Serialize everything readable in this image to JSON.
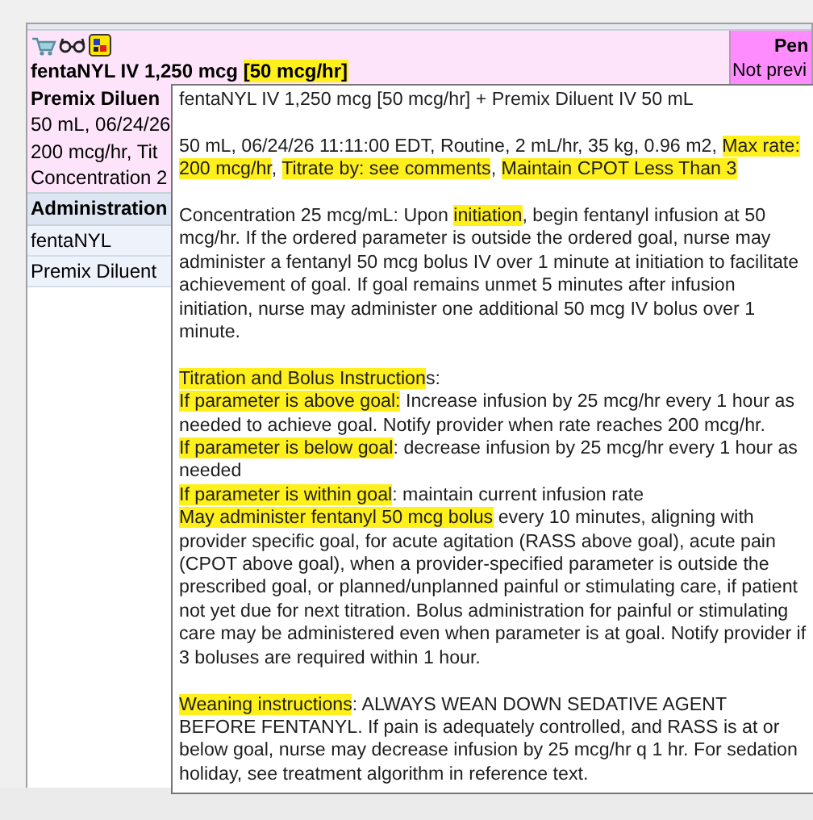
{
  "order": {
    "title": [
      {
        "text": "fentaNYL IV 1,250 mcg ",
        "highlight": false
      },
      {
        "text": "[50 mcg/hr]",
        "highlight": true
      }
    ],
    "lines": [
      "Premix Diluen",
      "50 mL, 06/24/26",
      "200 mcg/hr, Tit",
      "Concentration 2"
    ]
  },
  "status_column": {
    "title": "Pen",
    "subtitle": "Not previ"
  },
  "administration": {
    "heading": "Administration",
    "rows": [
      "fentaNYL",
      "Premix Diluent"
    ]
  },
  "tooltip": {
    "blocks": [
      {
        "lines": [
          [
            {
              "text": "fentaNYL IV 1,250 mcg [50 mcg/hr] + Premix Diluent IV 50 mL",
              "highlight": false
            }
          ]
        ]
      },
      {
        "lines": [
          [
            {
              "text": "50 mL, 06/24/26 11:11:00 EDT, Routine, 2 mL/hr, 35 kg, 0.96 m2, ",
              "highlight": false
            },
            {
              "text": "Max rate: 200 mcg/hr",
              "highlight": true
            },
            {
              "text": ", ",
              "highlight": false
            },
            {
              "text": "Titrate by: see comments",
              "highlight": true
            },
            {
              "text": ", ",
              "highlight": false
            },
            {
              "text": "Maintain CPOT Less Than 3",
              "highlight": true
            }
          ]
        ]
      },
      {
        "lines": [
          [
            {
              "text": "Concentration 25 mcg/mL: Upon ",
              "highlight": false
            },
            {
              "text": "initiation",
              "highlight": true
            },
            {
              "text": ", begin fentanyl infusion at 50 mcg/hr. If the ordered parameter is outside the ordered goal, nurse may administer a fentanyl 50 mcg bolus IV over 1 minute at initiation to facilitate achievement of goal. If goal remains unmet 5 minutes after infusion initiation, nurse may administer one additional 50 mcg IV bolus over 1 minute.",
              "highlight": false
            }
          ]
        ]
      },
      {
        "lines": [
          [
            {
              "text": "Titration and Bolus Instruction",
              "highlight": true
            },
            {
              "text": "s:",
              "highlight": false
            }
          ],
          [
            {
              "text": "If parameter is above goal:",
              "highlight": true
            },
            {
              "text": " Increase infusion by 25 mcg/hr every 1 hour as needed to achieve goal. Notify provider when rate reaches 200 mcg/hr.",
              "highlight": false
            }
          ],
          [
            {
              "text": "If parameter is below goal",
              "highlight": true
            },
            {
              "text": ": decrease infusion by 25 mcg/hr every 1 hour as needed",
              "highlight": false
            }
          ],
          [
            {
              "text": "If parameter is within goal",
              "highlight": true
            },
            {
              "text": ": maintain current infusion rate",
              "highlight": false
            }
          ],
          [
            {
              "text": "May administer fentanyl 50 mcg bolus",
              "highlight": true
            },
            {
              "text": " every 10 minutes, aligning with provider specific goal, for acute agitation (RASS above goal), acute pain (CPOT above goal), when a provider-specified parameter is outside the prescribed goal, or planned/unplanned painful or stimulating care, if patient not yet due for next titration. Bolus administration for painful or stimulating care may be administered even when parameter is at goal. Notify provider if 3 boluses are required within 1 hour.",
              "highlight": false
            }
          ]
        ]
      },
      {
        "lines": [
          [
            {
              "text": "Weaning instructions",
              "highlight": true
            },
            {
              "text": ": ALWAYS WEAN DOWN SEDATIVE AGENT BEFORE FENTANYL. If pain is adequately controlled, and RASS is at or below goal, nurse may decrease infusion by 25 mcg/hr q 1 hr. For sedation holiday, see treatment algorithm in reference text.",
              "highlight": false
            }
          ]
        ]
      }
    ]
  }
}
